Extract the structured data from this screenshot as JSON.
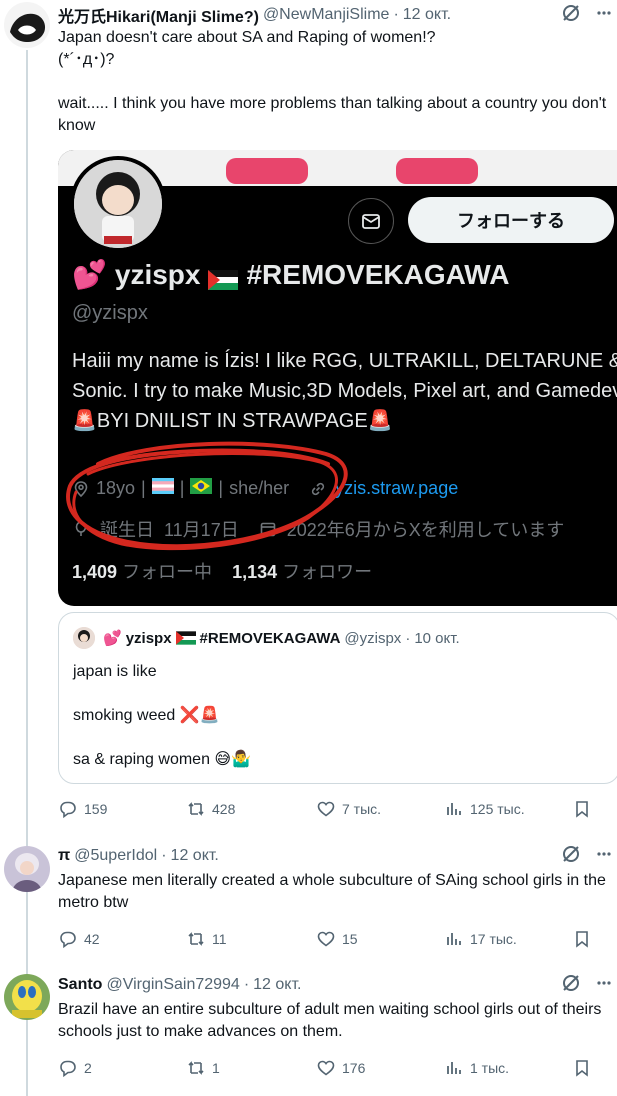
{
  "post1": {
    "name": "光万氏Hikari(Manji Slime?)",
    "handle": "@NewManjiSlime",
    "date": "12 окт.",
    "text": "Japan doesn't care about SA and Raping of women!?\n(*´･д･)?\n\nwait..... I think you have more problems than talking about a country you don't know",
    "screenshot": {
      "follow_label": "フォローする",
      "display_name": "yzispx",
      "display_name_suffix": "#REMOVEKAGAWA",
      "handle": "@yzispx",
      "bio": "Haiii my name is Ízis! I like RGG, ULTRAKILL, DELTARUNE & Sonic. I try to make Music,3D Models, Pixel art, and Gamedev. 🚨BYI DNILIST IN STRAWPAGE🚨",
      "meta_age": "18yo",
      "meta_sep1": "|",
      "meta_sep2": "|",
      "meta_sep3": "|",
      "meta_pronouns": "she/her",
      "meta_link": "yzis.straw.page",
      "birthday_label": "誕生日",
      "birthday": "11月17日",
      "joined": "2022年6月からXを利用しています",
      "following_count": "1,409",
      "following_label": "フォロー中",
      "followers_count": "1,134",
      "followers_label": "フォロワー"
    },
    "quote": {
      "name": "yzispx",
      "name_suffix": "#REMOVEKAGAWA",
      "handle": "@yzispx",
      "date": "10 окт.",
      "line1": "japan is like",
      "line2": "smoking weed ❌🚨",
      "line3": "sa & raping women 😅🤷‍♂️"
    },
    "actions": {
      "replies": "159",
      "reposts": "428",
      "likes": "7 тыс.",
      "views": "125 тыс."
    }
  },
  "post2": {
    "name": "π",
    "handle": "@5uperIdol",
    "date": "12 окт.",
    "text": "Japanese men literally created a whole subculture of SAing school girls in the metro btw",
    "actions": {
      "replies": "42",
      "reposts": "11",
      "likes": "15",
      "views": "17 тыс."
    }
  },
  "post3": {
    "name": "Santo",
    "handle": "@VirginSain72994",
    "date": "12 окт.",
    "text": "Brazil have an entire subculture of adult men waiting school girls out of theirs schools just to make advances on them.",
    "actions": {
      "replies": "2",
      "reposts": "1",
      "likes": "176",
      "views": "1 тыс."
    }
  },
  "separator": "·",
  "colors": {
    "accent": "#1d9bf0",
    "muted": "#536471",
    "scribble": "#d4281f"
  }
}
